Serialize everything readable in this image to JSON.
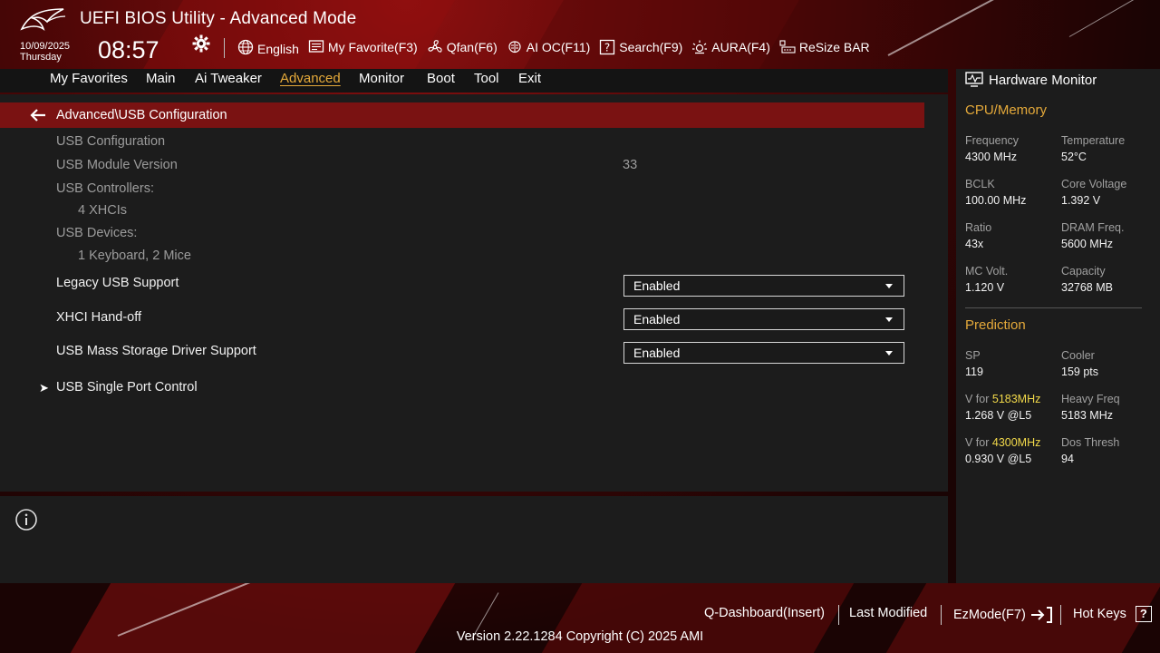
{
  "header": {
    "title": "UEFI BIOS Utility - Advanced Mode",
    "date": "10/09/2025",
    "day": "Thursday",
    "time": "08:57",
    "toolbar": [
      {
        "label": "English",
        "icon": "globe-icon"
      },
      {
        "label": "My Favorite(F3)",
        "icon": "favorite-icon"
      },
      {
        "label": "Qfan(F6)",
        "icon": "fan-icon"
      },
      {
        "label": "AI OC(F11)",
        "icon": "ai-chip-icon"
      },
      {
        "label": "Search(F9)",
        "icon": "search-help-icon"
      },
      {
        "label": "AURA(F4)",
        "icon": "aura-light-icon"
      },
      {
        "label": "ReSize BAR",
        "icon": "resize-bar-icon"
      }
    ]
  },
  "nav": {
    "tabs": [
      "My Favorites",
      "Main",
      "Ai Tweaker",
      "Advanced",
      "Monitor",
      "Boot",
      "Tool",
      "Exit"
    ],
    "active": "Advanced"
  },
  "main": {
    "path": "Advanced\\USB Configuration",
    "items": {
      "usb_config": "USB Configuration",
      "usb_module_version_label": "USB Module Version",
      "usb_module_version_value": "33",
      "usb_controllers_label": "USB Controllers:",
      "usb_controllers_value": "4 XHCIs",
      "usb_devices_label": "USB Devices:",
      "usb_devices_value": "1 Keyboard, 2 Mice",
      "legacy_usb_label": "Legacy USB Support",
      "legacy_usb_value": "Enabled",
      "xhci_label": "XHCI Hand-off",
      "xhci_value": "Enabled",
      "mass_storage_label": "USB Mass Storage Driver Support",
      "mass_storage_value": "Enabled",
      "single_port_label": "USB Single Port Control"
    }
  },
  "hw": {
    "title": "Hardware Monitor",
    "cpu_title": "CPU/Memory",
    "cpu": [
      {
        "label": "Frequency",
        "value": "4300 MHz"
      },
      {
        "label": "Temperature",
        "value": "52°C"
      },
      {
        "label": "BCLK",
        "value": "100.00 MHz"
      },
      {
        "label": "Core Voltage",
        "value": "1.392 V"
      },
      {
        "label": "Ratio",
        "value": "43x"
      },
      {
        "label": "DRAM Freq.",
        "value": "5600 MHz"
      },
      {
        "label": "MC Volt.",
        "value": "1.120 V"
      },
      {
        "label": "Capacity",
        "value": "32768 MB"
      }
    ],
    "pred_title": "Prediction",
    "pred": {
      "sp_label": "SP",
      "sp_value": "119",
      "cooler_label": "Cooler",
      "cooler_value": "159 pts",
      "v1_prefix": "V for ",
      "v1_freq": "5183MHz",
      "v1_value": "1.268 V @L5",
      "heavy_label": "Heavy Freq",
      "heavy_value": "5183 MHz",
      "v2_prefix": "V for ",
      "v2_freq": "4300MHz",
      "v2_value": "0.930 V @L5",
      "dos_label": "Dos Thresh",
      "dos_value": "94"
    }
  },
  "footer": {
    "qdash": "Q-Dashboard(Insert)",
    "last_modified": "Last Modified",
    "ezmode": "EzMode(F7)",
    "hotkeys": "Hot Keys",
    "hotkeys_glyph": "?",
    "version": "Version 2.22.1284 Copyright (C) 2025 AMI"
  },
  "colors": {
    "accent": "#e4a93a",
    "highlight": "#f2d94a",
    "path_bar": "#7a1212",
    "panel": "#1c1c1c"
  }
}
